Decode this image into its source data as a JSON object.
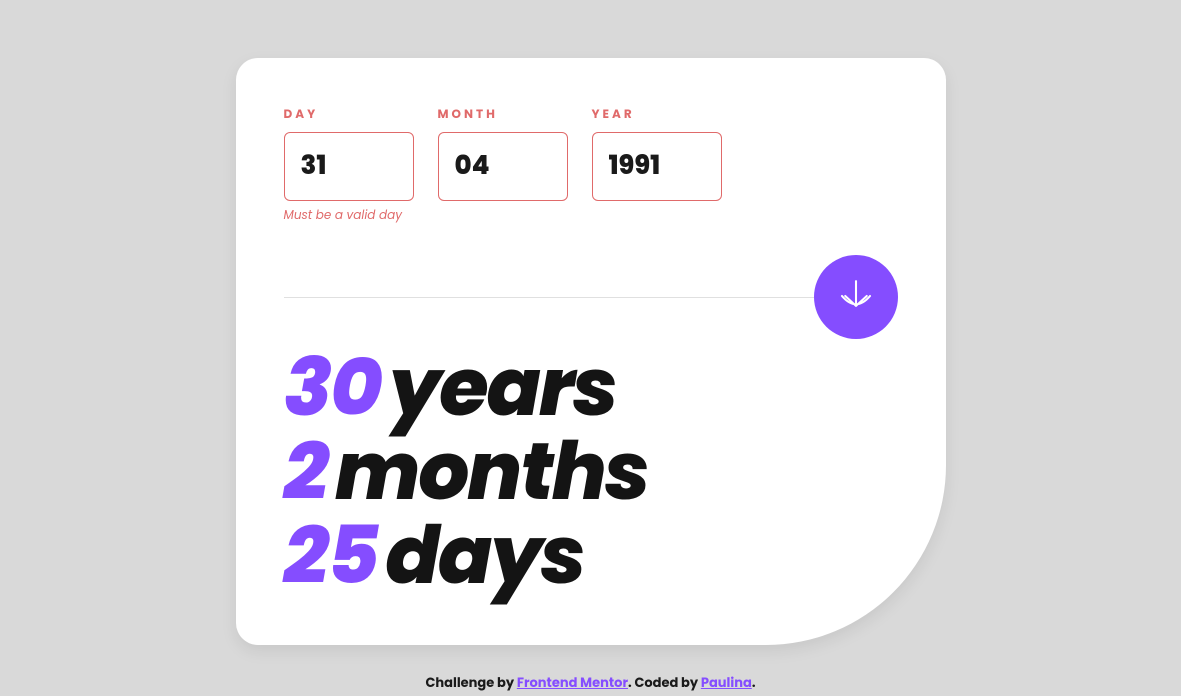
{
  "form": {
    "day": {
      "label": "DAY",
      "value": "31",
      "error": "Must be a valid day"
    },
    "month": {
      "label": "MONTH",
      "value": "04"
    },
    "year": {
      "label": "YEAR",
      "value": "1991"
    }
  },
  "result": {
    "years": "30",
    "years_label": "years",
    "months": "2",
    "months_label": "months",
    "days": "25",
    "days_label": "days"
  },
  "attribution": {
    "prefix": "Challenge by ",
    "link1_text": "Frontend Mentor",
    "middle": ". Coded by ",
    "link2_text": "Paulina",
    "suffix": "."
  }
}
